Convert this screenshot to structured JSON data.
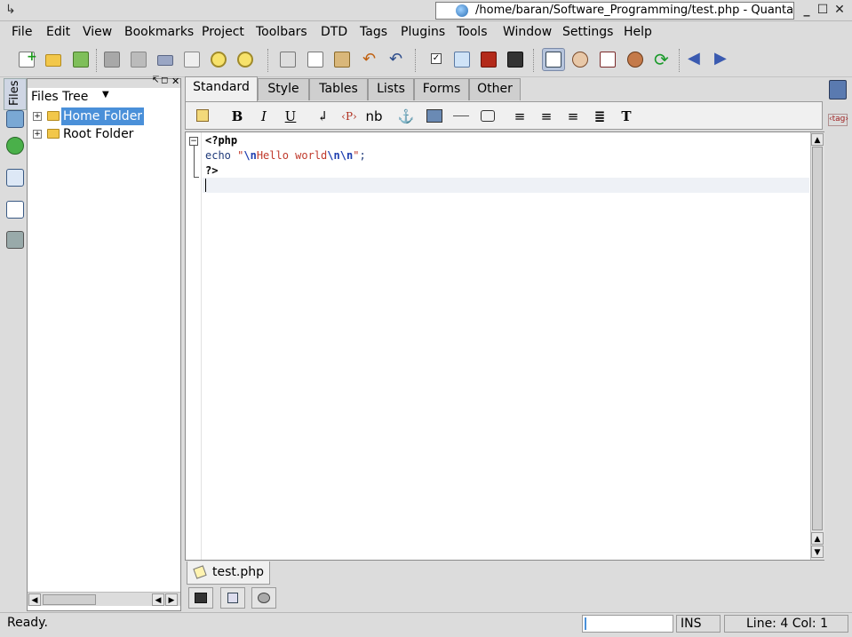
{
  "window": {
    "title": "/home/baran/Software_Programming/test.php - Quanta"
  },
  "menubar": {
    "items": [
      {
        "label": "File"
      },
      {
        "label": "Edit"
      },
      {
        "label": "View"
      },
      {
        "label": "Bookmarks"
      },
      {
        "label": "Project"
      },
      {
        "label": "Toolbars"
      },
      {
        "label": "DTD"
      },
      {
        "label": "Tags"
      },
      {
        "label": "Plugins"
      },
      {
        "label": "Tools"
      },
      {
        "label": "Window"
      },
      {
        "label": "Settings"
      },
      {
        "label": "Help"
      }
    ]
  },
  "toolbar": {
    "icons": [
      "new-file-icon",
      "open-file-icon",
      "open-project-icon",
      "save-icon",
      "save-all-icon",
      "print-icon",
      "print-preview-icon",
      "zoom-in-icon",
      "zoom-out-icon",
      "cut-icon",
      "copy-icon",
      "paste-icon",
      "undo-icon",
      "redo-icon",
      "checkbox-icon",
      "find-icon",
      "tag-structure-icon",
      "xsl-icon",
      "editor-view-icon",
      "preview-icon",
      "split-view-icon",
      "browser-preview-icon",
      "reload-icon",
      "back-icon",
      "forward-icon"
    ]
  },
  "leftstrip": {
    "files_tab": "Files"
  },
  "filetree": {
    "title": "Files Tree",
    "items": [
      {
        "label": "Home Folder",
        "expander": "+",
        "selected": true
      },
      {
        "label": "Root Folder",
        "expander": "+",
        "selected": false
      }
    ]
  },
  "tag_tabs": [
    {
      "label": "Standard",
      "active": true
    },
    {
      "label": "Style"
    },
    {
      "label": "Tables"
    },
    {
      "label": "Lists"
    },
    {
      "label": "Forms"
    },
    {
      "label": "Other"
    }
  ],
  "tagbar": {
    "bold": "B",
    "italic": "I",
    "underline": "U",
    "paragraph": "‹P›",
    "nbsp": "nb",
    "text_tag": "T"
  },
  "editor": {
    "lines": [
      {
        "segments": [
          {
            "text": "<?php",
            "cls": "kw"
          }
        ]
      },
      {
        "segments": [
          {
            "text": "echo ",
            "cls": "echo"
          },
          {
            "text": "\"",
            "cls": "str"
          },
          {
            "text": "\\n",
            "cls": "esc"
          },
          {
            "text": "Hello world",
            "cls": "str"
          },
          {
            "text": "\\n\\n",
            "cls": "esc"
          },
          {
            "text": "\"",
            "cls": "str"
          },
          {
            "text": ";",
            "cls": "echo"
          }
        ]
      },
      {
        "segments": [
          {
            "text": "?>",
            "cls": "kw"
          }
        ]
      },
      {
        "segments": []
      }
    ]
  },
  "document_tab": {
    "label": "test.php"
  },
  "statusbar": {
    "message": "Ready.",
    "mode": "INS",
    "position": "Line: 4 Col: 1"
  },
  "colors": {
    "selection": "#4a90d9",
    "current_line": "#eef1f6",
    "string": "#c0392b",
    "escape": "#1f3fb0"
  }
}
